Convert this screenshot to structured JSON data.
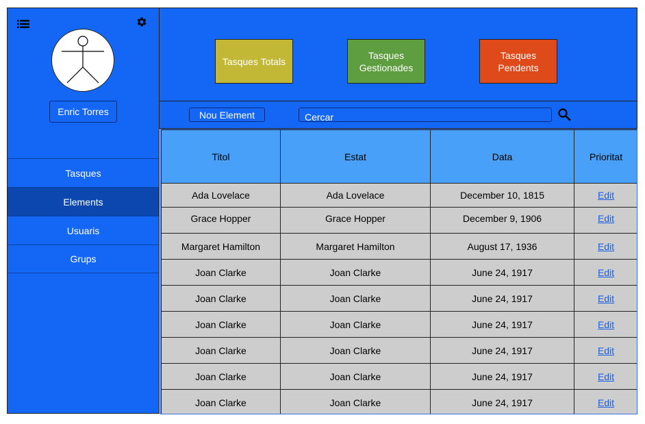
{
  "sidebar": {
    "user_name": "Enric Torres",
    "items": [
      {
        "label": "Tasques",
        "active": false
      },
      {
        "label": "Elements",
        "active": true
      },
      {
        "label": "Usuaris",
        "active": false
      },
      {
        "label": "Grups",
        "active": false
      }
    ]
  },
  "stats": [
    {
      "label": "Tasques Totals",
      "color": "#c3b836"
    },
    {
      "label": "Tasques Gestionades",
      "color": "#5e9d40"
    },
    {
      "label": "Tasques Pendents",
      "color": "#df4a1b"
    }
  ],
  "toolbar": {
    "new_label": "Nou Element",
    "search_placeholder": "Cercar"
  },
  "table": {
    "headers": [
      "Titol",
      "Estat",
      "Data",
      "Prioritat"
    ],
    "rows": [
      {
        "titol": "Ada Lovelace",
        "estat": "Ada Lovelace",
        "data": "December 10, 1815",
        "action": "Edit"
      },
      {
        "titol": "Grace Hopper",
        "estat": "Grace Hopper",
        "data": "December 9, 1906",
        "action": "Edit"
      },
      {
        "titol": "Margaret Hamilton",
        "estat": "Margaret Hamilton",
        "data": "August 17, 1936",
        "action": "Edit"
      },
      {
        "titol": "Joan Clarke",
        "estat": "Joan Clarke",
        "data": "June 24, 1917",
        "action": "Edit"
      },
      {
        "titol": "Joan Clarke",
        "estat": "Joan Clarke",
        "data": "June 24, 1917",
        "action": "Edit"
      },
      {
        "titol": "Joan Clarke",
        "estat": "Joan Clarke",
        "data": "June 24, 1917",
        "action": "Edit"
      },
      {
        "titol": "Joan Clarke",
        "estat": "Joan Clarke",
        "data": "June 24, 1917",
        "action": "Edit"
      },
      {
        "titol": "Joan Clarke",
        "estat": "Joan Clarke",
        "data": "June 24, 1917",
        "action": "Edit"
      },
      {
        "titol": "Joan Clarke",
        "estat": "Joan Clarke",
        "data": "June 24, 1917",
        "action": "Edit"
      }
    ]
  },
  "icons": {
    "menu": "list-icon",
    "settings": "gear-icon",
    "search": "search-icon",
    "avatar": "stick-figure-avatar"
  }
}
